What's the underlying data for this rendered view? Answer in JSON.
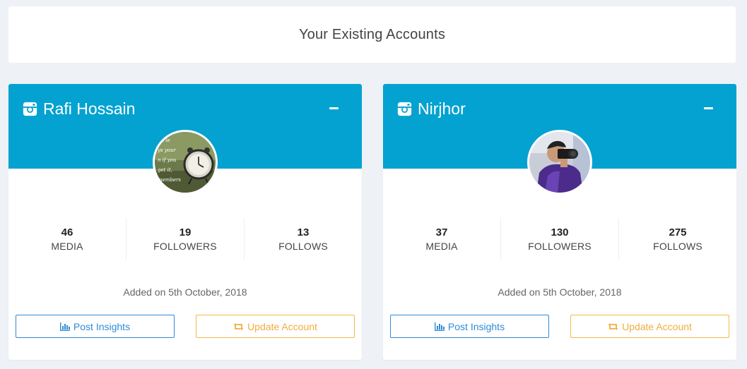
{
  "header": {
    "title": "Your Existing Accounts"
  },
  "accounts": [
    {
      "name": "Rafi Hossain",
      "avatar": "alarm-clock-photo",
      "stats": [
        {
          "value": "46",
          "label": "MEDIA"
        },
        {
          "value": "19",
          "label": "FOLLOWERS"
        },
        {
          "value": "13",
          "label": "FOLLOWS"
        }
      ],
      "added": "Added on 5th October, 2018",
      "insights_label": "Post Insights",
      "update_label": "Update Account"
    },
    {
      "name": "Nirjhor",
      "avatar": "photographer-photo",
      "stats": [
        {
          "value": "37",
          "label": "MEDIA"
        },
        {
          "value": "130",
          "label": "FOLLOWERS"
        },
        {
          "value": "275",
          "label": "FOLLOWS"
        }
      ],
      "added": "Added on 5th October, 2018",
      "insights_label": "Post Insights",
      "update_label": "Update Account"
    }
  ],
  "icons": {
    "account": "instagram-icon",
    "collapse": "minus-icon",
    "insights": "bar-chart-icon",
    "update": "retweet-icon"
  },
  "colors": {
    "banner": "#03a2d1",
    "insights": "#2f8bd7",
    "update": "#f0ad3c",
    "background": "#eef1f6"
  }
}
